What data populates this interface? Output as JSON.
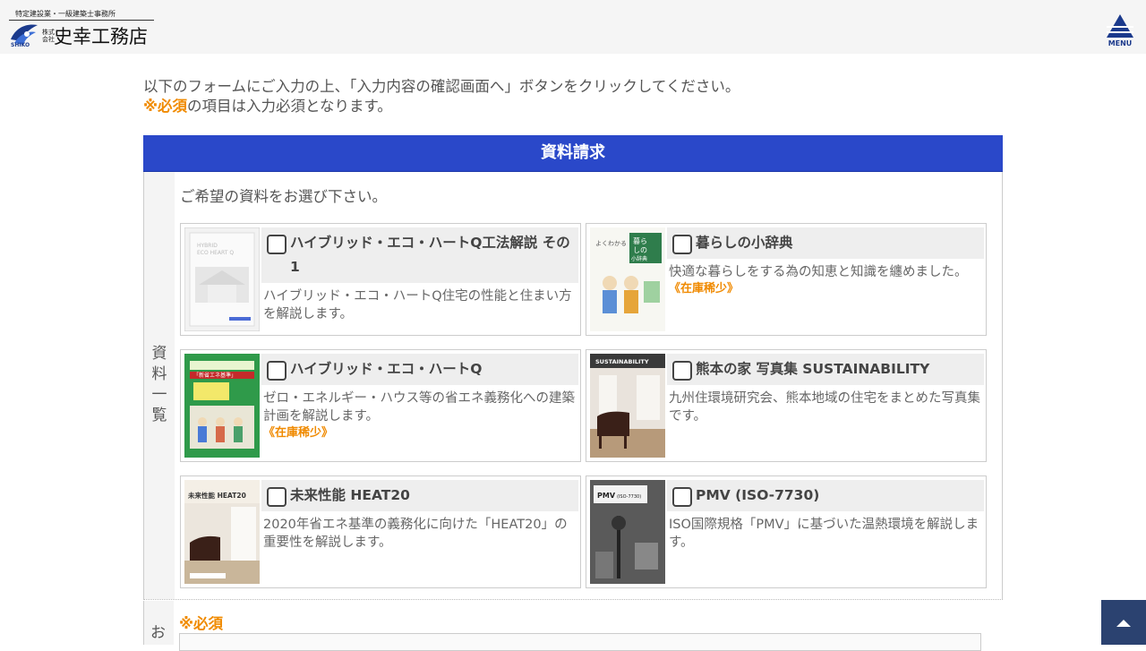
{
  "header": {
    "logo_subtitle": "特定建設業・一級建築士事務所",
    "logo_corp": "株式会社",
    "logo_name": "史幸工務店",
    "logo_roman": "SHIKO",
    "menu_label": "MENU"
  },
  "intro": {
    "line1": "以下のフォームにご入力の上、「入力内容の確認画面へ」ボタンをクリックしてください。",
    "required_mark": "※必須",
    "line2_rest": "の項目は入力必須となります。"
  },
  "form": {
    "title": "資料請求",
    "section_label": "資料一覧",
    "prompt": "ご希望の資料をお選び下さい。",
    "stock_label": "《在庫稀少》",
    "items": [
      {
        "title": "ハイブリッド・エコ・ハートQ工法解説 その1",
        "desc": "ハイブリッド・エコ・ハートQ住宅の性能と住まい方を解説します。",
        "low_stock": false,
        "checked": false
      },
      {
        "title": "暮らしの小辞典",
        "desc": "快適な暮らしをする為の知恵と知識を纏めました。",
        "low_stock": true,
        "checked": false
      },
      {
        "title": "ハイブリッド・エコ・ハートQ",
        "desc": "ゼロ・エネルギー・ハウス等の省エネ義務化への建築計画を解説します。",
        "low_stock": true,
        "checked": false
      },
      {
        "title": "熊本の家 写真集 SUSTAINABILITY",
        "desc": "九州住環境研究会、熊本地域の住宅をまとめた写真集です。",
        "low_stock": false,
        "checked": false
      },
      {
        "title": "未来性能 HEAT20",
        "desc": "2020年省エネ基準の義務化に向けた「HEAT20」の重要性を解説します。",
        "low_stock": false,
        "checked": false
      },
      {
        "title": "PMV (ISO-7730)",
        "desc": "ISO国際規格「PMV」に基づいた温熱環境を解説します。",
        "low_stock": false,
        "checked": false
      }
    ],
    "thumb_texts": {
      "t1": "HYBRID ECO HEART Q",
      "t2": "暮らしの小辞典",
      "t3": "「新省エネ基準」",
      "t4": "SUSTAINABILITY",
      "t5": "未来性能 HEAT20",
      "t6": "PMV (ISO-7730)"
    },
    "next_section_label": "お",
    "next_required": "※必須"
  },
  "colors": {
    "header_bar": "#2a48c9",
    "accent_orange": "#f08a00",
    "brand_navy": "#1b3a8c",
    "to_top_bg": "#2b4270"
  },
  "icons": {
    "menu": "triangle-menu-icon",
    "to_top": "arrow-up-icon",
    "checkbox": "checkbox-icon"
  }
}
